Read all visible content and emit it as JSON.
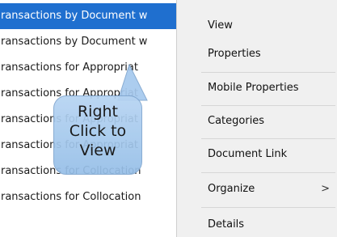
{
  "list": {
    "rows": [
      "ransactions by Document w",
      "ransactions by Document w",
      "ransactions for Appropriat",
      "ransactions for Appropriat",
      "ransactions for Appropriat",
      "ransactions for Appropriat",
      "ransactions for Collocation",
      "ransactions for Collocation"
    ],
    "selected_index": 0
  },
  "context_menu": {
    "items": [
      {
        "label": "View"
      },
      {
        "label": "Properties"
      },
      {
        "label": "Mobile Properties"
      },
      {
        "label": "Categories"
      },
      {
        "label": "Document Link"
      },
      {
        "label": "Organize",
        "submenu_indicator": ">"
      },
      {
        "label": "Details"
      }
    ]
  },
  "callout": {
    "line1": "Right",
    "line2": "Click to",
    "line3": "View"
  },
  "colors": {
    "selection": "#1f6fcf",
    "menu_bg": "#f0f0f0",
    "callout": "#a8cdf0"
  }
}
